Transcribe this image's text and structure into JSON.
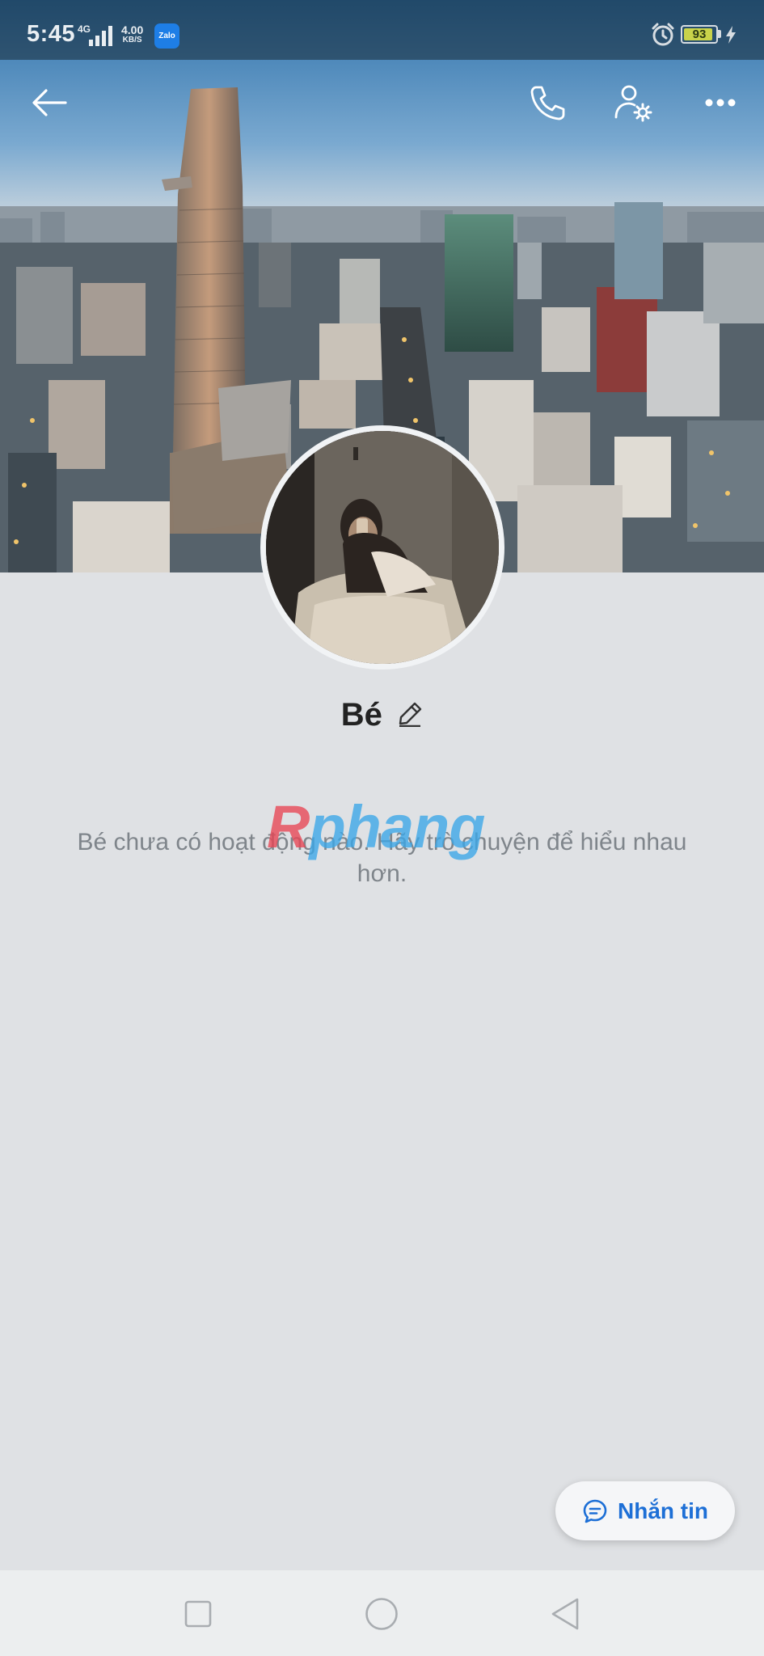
{
  "status_bar": {
    "time": "5:45",
    "network": "4G",
    "speed_value": "4.00",
    "speed_unit": "KB/S",
    "notification_app": "Zalo",
    "battery_level": "93",
    "battery_fraction": 0.93,
    "icons": [
      "signal-icon",
      "zalo-app-icon",
      "alarm-icon",
      "battery-icon",
      "charging-icon"
    ]
  },
  "header": {
    "icons": [
      "back-arrow-icon",
      "phone-call-icon",
      "profile-settings-icon",
      "more-options-icon"
    ]
  },
  "profile": {
    "name": "Bé",
    "edit_icon": "pencil-edit-icon"
  },
  "watermark": {
    "first_letter": "R",
    "rest": "phang"
  },
  "feed": {
    "empty_message": "Bé chưa có hoạt động nào. Hãy trò chuyện để hiểu nhau hơn."
  },
  "message_button": {
    "label": "Nhắn tin",
    "icon": "chat-bubble-icon",
    "color": "#1d6fd6"
  },
  "nav_bar": {
    "icons": [
      "recent-apps-icon",
      "home-icon",
      "back-triangle-icon"
    ]
  }
}
